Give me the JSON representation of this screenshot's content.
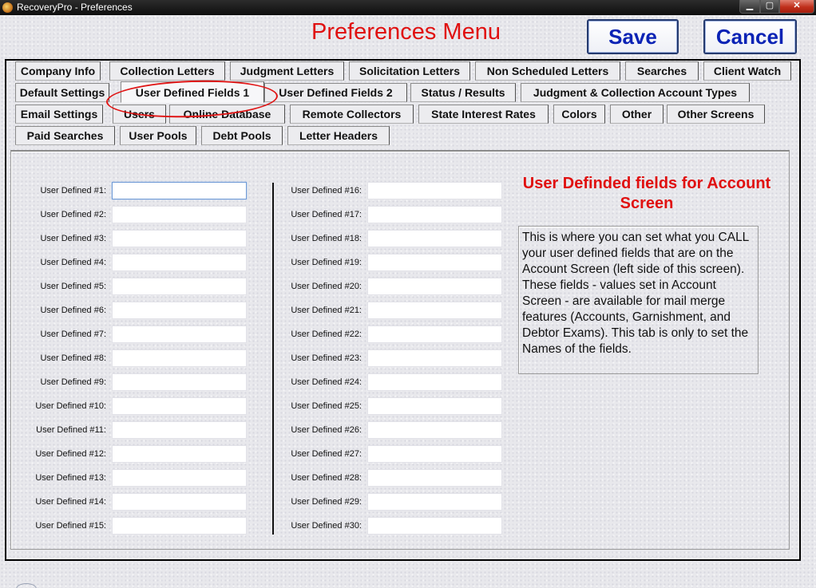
{
  "window": {
    "title": "RecoveryPro - Preferences",
    "minimize_symbol": "▁",
    "maximize_symbol": "▢",
    "close_symbol": "✕"
  },
  "header": {
    "title": "Preferences Menu",
    "save_label": "Save",
    "cancel_label": "Cancel"
  },
  "tabs": [
    {
      "label": "Company Info",
      "active": false
    },
    {
      "label": "Collection Letters",
      "active": false
    },
    {
      "label": "Judgment Letters",
      "active": false
    },
    {
      "label": "Solicitation Letters",
      "active": false
    },
    {
      "label": "Non Scheduled Letters",
      "active": false
    },
    {
      "label": "Searches",
      "active": false
    },
    {
      "label": "Client Watch",
      "active": false
    },
    {
      "label": "Default Settings",
      "active": false
    },
    {
      "label": "User Defined Fields 1",
      "active": true
    },
    {
      "label": "User Defined Fields 2",
      "active": false
    },
    {
      "label": "Status / Results",
      "active": false
    },
    {
      "label": "Judgment & Collection Account Types",
      "active": false
    },
    {
      "label": "Email Settings",
      "active": false
    },
    {
      "label": "Users",
      "active": false
    },
    {
      "label": "Online Database",
      "active": false
    },
    {
      "label": "Remote Collectors",
      "active": false
    },
    {
      "label": "State Interest Rates",
      "active": false
    },
    {
      "label": "Colors",
      "active": false
    },
    {
      "label": "Other",
      "active": false
    },
    {
      "label": "Other Screens",
      "active": false
    },
    {
      "label": "Paid Searches",
      "active": false
    },
    {
      "label": "User Pools",
      "active": false
    },
    {
      "label": "Debt Pools",
      "active": false
    },
    {
      "label": "Letter Headers",
      "active": false
    }
  ],
  "fields": [
    {
      "label": "User Defined #1:",
      "value": ""
    },
    {
      "label": "User Defined #2:",
      "value": ""
    },
    {
      "label": "User Defined #3:",
      "value": ""
    },
    {
      "label": "User Defined #4:",
      "value": ""
    },
    {
      "label": "User Defined #5:",
      "value": ""
    },
    {
      "label": "User Defined #6:",
      "value": ""
    },
    {
      "label": "User Defined #7:",
      "value": ""
    },
    {
      "label": "User Defined #8:",
      "value": ""
    },
    {
      "label": "User Defined #9:",
      "value": ""
    },
    {
      "label": "User Defined #10:",
      "value": ""
    },
    {
      "label": "User Defined #11:",
      "value": ""
    },
    {
      "label": "User Defined #12:",
      "value": ""
    },
    {
      "label": "User Defined #13:",
      "value": ""
    },
    {
      "label": "User Defined #14:",
      "value": ""
    },
    {
      "label": "User Defined #15:",
      "value": ""
    },
    {
      "label": "User Defined #16:",
      "value": ""
    },
    {
      "label": "User Defined #17:",
      "value": ""
    },
    {
      "label": "User Defined #18:",
      "value": ""
    },
    {
      "label": "User Defined #19:",
      "value": ""
    },
    {
      "label": "User Defined #20:",
      "value": ""
    },
    {
      "label": "User Defined #21:",
      "value": ""
    },
    {
      "label": "User Defined #22:",
      "value": ""
    },
    {
      "label": "User Defined #23:",
      "value": ""
    },
    {
      "label": "User Defined #24:",
      "value": ""
    },
    {
      "label": "User Defined #25:",
      "value": ""
    },
    {
      "label": "User Defined #26:",
      "value": ""
    },
    {
      "label": "User Defined #27:",
      "value": ""
    },
    {
      "label": "User Defined #28:",
      "value": ""
    },
    {
      "label": "User Defined #29:",
      "value": ""
    },
    {
      "label": "User Defined #30:",
      "value": ""
    }
  ],
  "info": {
    "heading": "User Definded fields for Account Screen",
    "text": "This is where you can set what you CALL your user defined fields that are on the Account Screen (left side of this screen). These fields - values set in Account Screen - are available for mail merge features (Accounts, Garnishment, and Debtor Exams). This tab is only to set the Names of the fields."
  },
  "colors": {
    "heading_red": "#e01010",
    "button_text_blue": "#0b23b5",
    "annotation_red": "#e01515"
  }
}
